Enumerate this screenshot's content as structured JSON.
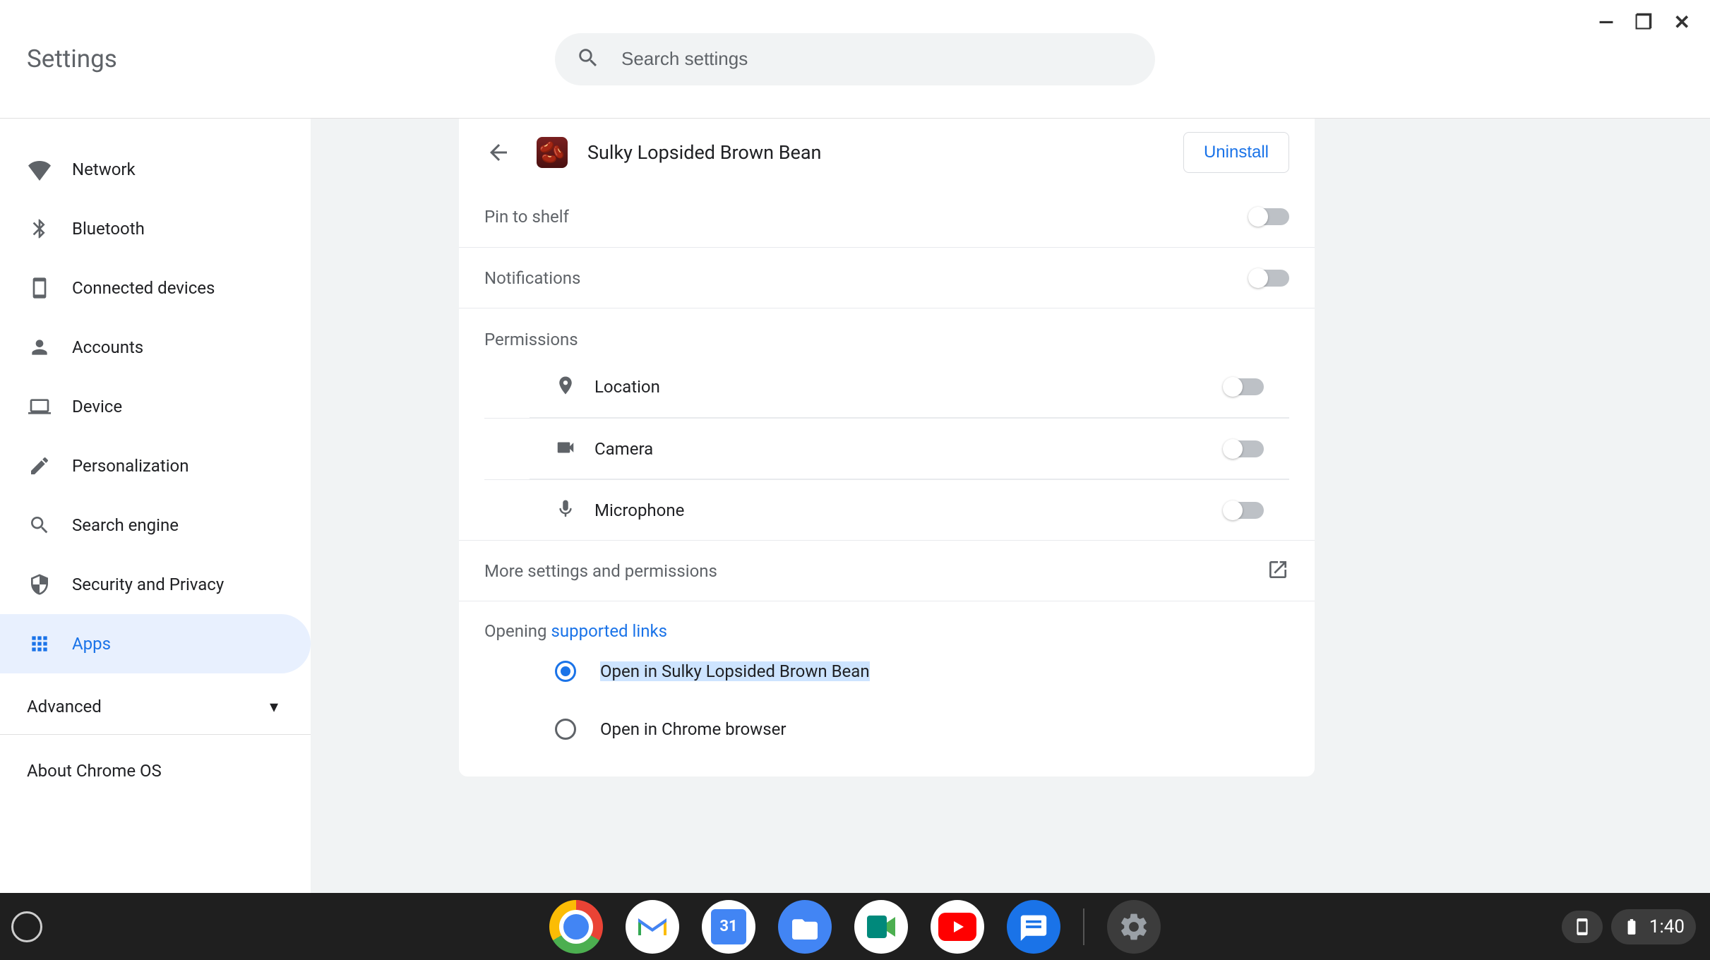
{
  "window": {
    "minimize": "—",
    "maximize": "❐",
    "close": "✕"
  },
  "header": {
    "title": "Settings",
    "search_placeholder": "Search settings"
  },
  "sidebar": {
    "items": [
      {
        "label": "Network"
      },
      {
        "label": "Bluetooth"
      },
      {
        "label": "Connected devices"
      },
      {
        "label": "Accounts"
      },
      {
        "label": "Device"
      },
      {
        "label": "Personalization"
      },
      {
        "label": "Search engine"
      },
      {
        "label": "Security and Privacy"
      },
      {
        "label": "Apps"
      }
    ],
    "advanced": "Advanced",
    "about": "About Chrome OS"
  },
  "app_detail": {
    "name": "Sulky Lopsided Brown Bean",
    "uninstall": "Uninstall",
    "pin_to_shelf": "Pin to shelf",
    "notifications": "Notifications",
    "permissions_header": "Permissions",
    "permissions": {
      "location": "Location",
      "camera": "Camera",
      "microphone": "Microphone"
    },
    "more_settings": "More settings and permissions",
    "opening_prefix": "Opening ",
    "opening_link": "supported links",
    "open_in_app": "Open in Sulky Lopsided Brown Bean",
    "open_in_chrome": "Open in Chrome browser"
  },
  "shelf": {
    "time": "1:40",
    "calendar_day": "31"
  }
}
